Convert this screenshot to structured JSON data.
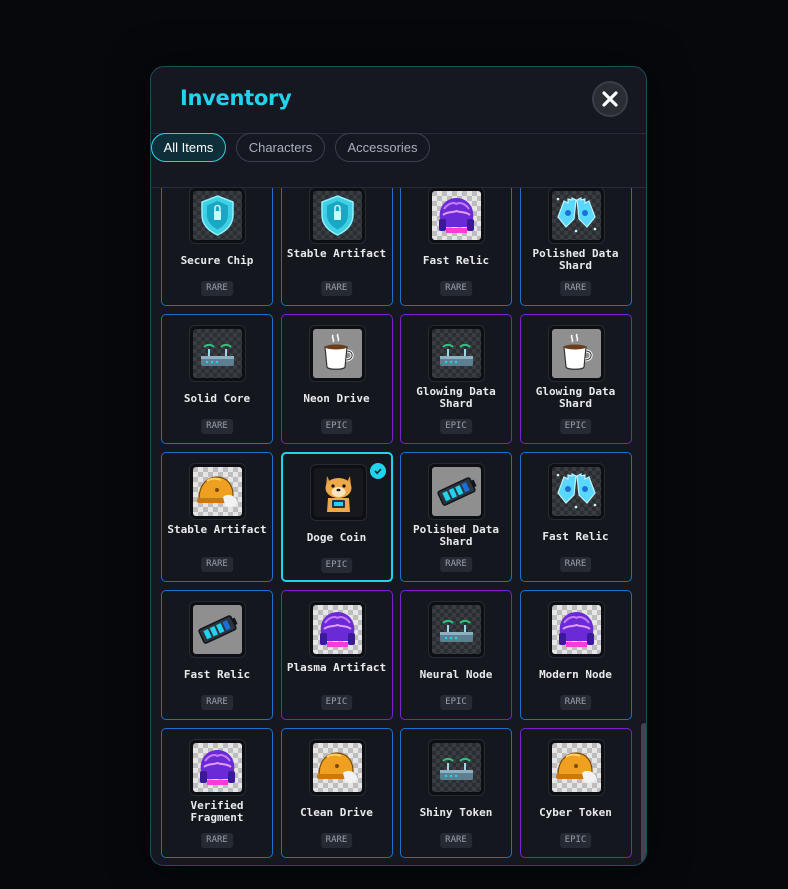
{
  "modal": {
    "title": "Inventory",
    "close_icon": "close-icon"
  },
  "tabs": [
    {
      "label": "All Items",
      "active": true
    },
    {
      "label": "Characters",
      "active": false
    },
    {
      "label": "Accessories",
      "active": false
    }
  ],
  "items": [
    {
      "name": "Secure Chip",
      "rarity": "RARE",
      "icon": "shield-icon"
    },
    {
      "name": "Stable Artifact",
      "rarity": "RARE",
      "icon": "shield-icon"
    },
    {
      "name": "Fast Relic",
      "rarity": "RARE",
      "icon": "brain-icon"
    },
    {
      "name": "Polished Data Shard",
      "rarity": "RARE",
      "icon": "gloves-icon"
    },
    {
      "name": "Solid Core",
      "rarity": "RARE",
      "icon": "router-icon"
    },
    {
      "name": "Neon Drive",
      "rarity": "EPIC",
      "icon": "coffee-icon"
    },
    {
      "name": "Glowing Data Shard",
      "rarity": "EPIC",
      "icon": "router-icon"
    },
    {
      "name": "Glowing Data Shard",
      "rarity": "EPIC",
      "icon": "coffee-icon"
    },
    {
      "name": "Stable Artifact",
      "rarity": "RARE",
      "icon": "helmet-icon"
    },
    {
      "name": "Doge Coin",
      "rarity": "EPIC",
      "icon": "doge-icon",
      "selected": true
    },
    {
      "name": "Polished Data Shard",
      "rarity": "RARE",
      "icon": "battery-icon"
    },
    {
      "name": "Fast Relic",
      "rarity": "RARE",
      "icon": "gloves-icon"
    },
    {
      "name": "Fast Relic",
      "rarity": "RARE",
      "icon": "battery-icon"
    },
    {
      "name": "Plasma Artifact",
      "rarity": "EPIC",
      "icon": "brain-icon"
    },
    {
      "name": "Neural Node",
      "rarity": "EPIC",
      "icon": "router-icon"
    },
    {
      "name": "Modern Node",
      "rarity": "RARE",
      "icon": "brain-icon"
    },
    {
      "name": "Verified Fragment",
      "rarity": "RARE",
      "icon": "brain-icon"
    },
    {
      "name": "Clean Drive",
      "rarity": "RARE",
      "icon": "helmet-icon"
    },
    {
      "name": "Shiny Token",
      "rarity": "RARE",
      "icon": "router-icon"
    },
    {
      "name": "Cyber Token",
      "rarity": "EPIC",
      "icon": "helmet-icon"
    }
  ],
  "colors": {
    "accent": "#22d3ee",
    "rare_border": "#1f6fc4",
    "epic_border": "#7a22c9"
  }
}
